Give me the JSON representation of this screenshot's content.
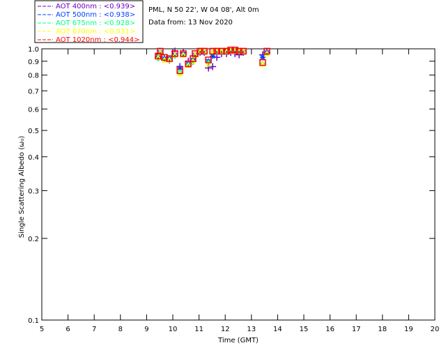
{
  "header": {
    "site": "PML, N 50 22', W 04 08', Alt 0m",
    "date": "Data from: 13 Nov 2020"
  },
  "chart_data": {
    "type": "scatter",
    "xlabel": "Time (GMT)",
    "ylabel": "Single Scattering Albedo (ω₀)",
    "xlim": [
      5,
      20
    ],
    "ylim": [
      0.1,
      1.0
    ],
    "yscale": "log",
    "xticks": [
      "5",
      "6",
      "7",
      "8",
      "9",
      "10",
      "11",
      "12",
      "13",
      "14",
      "15",
      "16",
      "17",
      "18",
      "19",
      "20"
    ],
    "yticks": [
      "0.1",
      "0.2",
      "0.3",
      "0.4",
      "0.5",
      "0.6",
      "0.7",
      "0.8",
      "0.9",
      "1.0"
    ],
    "legend_position": "top-left",
    "series": [
      {
        "name": "AOT  400nm : <0.939>",
        "color": "#6a00c0",
        "marker": "plus",
        "x": [
          9.52,
          9.44,
          9.68,
          9.87,
          10.08,
          10.27,
          10.4,
          10.59,
          10.77,
          10.85,
          11.04,
          11.2,
          11.36,
          11.52,
          11.68,
          11.86,
          12.05,
          12.21,
          12.37,
          12.53,
          12.69,
          13.43,
          13.59
        ],
        "y": [
          0.95,
          0.93,
          0.92,
          0.91,
          0.98,
          0.86,
          0.97,
          0.9,
          0.9,
          0.94,
          0.97,
          0.97,
          0.85,
          0.86,
          0.93,
          0.96,
          0.96,
          0.97,
          0.96,
          0.95,
          0.97,
          0.95,
          0.97
        ]
      },
      {
        "name": "AOT  500nm : <0.938>",
        "color": "#0040ff",
        "marker": "star",
        "x": [
          9.52,
          9.44,
          9.68,
          9.87,
          10.08,
          10.27,
          10.4,
          10.59,
          10.77,
          10.85,
          11.04,
          11.2,
          11.36,
          11.52,
          11.68,
          11.86,
          12.05,
          12.21,
          12.37,
          12.53,
          12.69,
          13.43,
          13.59
        ],
        "y": [
          0.97,
          0.94,
          0.92,
          0.92,
          0.95,
          0.85,
          0.95,
          0.88,
          0.91,
          0.95,
          0.97,
          0.97,
          0.9,
          0.94,
          0.97,
          0.97,
          0.97,
          0.98,
          0.98,
          0.97,
          0.97,
          0.93,
          0.97
        ]
      },
      {
        "name": "AOT  675nm : <0.928>",
        "color": "#00ff80",
        "marker": "diamond",
        "x": [
          9.52,
          9.44,
          9.68,
          9.87,
          10.08,
          10.27,
          10.4,
          10.59,
          10.77,
          10.85,
          11.04,
          11.2,
          11.36,
          11.52,
          11.68,
          11.86,
          12.05,
          12.21,
          12.37,
          12.53,
          12.69,
          13.43,
          13.59
        ],
        "y": [
          0.96,
          0.92,
          0.91,
          0.91,
          0.94,
          0.82,
          0.95,
          0.87,
          0.9,
          0.94,
          0.97,
          0.97,
          0.89,
          0.97,
          0.97,
          0.97,
          0.97,
          0.98,
          0.98,
          0.97,
          0.97,
          0.88,
          0.96
        ]
      },
      {
        "name": "AOT  870nm : <0.931>",
        "color": "#ffff00",
        "marker": "triangle",
        "x": [
          9.52,
          9.44,
          9.68,
          9.87,
          10.08,
          10.27,
          10.4,
          10.59,
          10.77,
          10.85,
          11.04,
          11.2,
          11.36,
          11.52,
          11.68,
          11.86,
          12.05,
          12.21,
          12.37,
          12.53,
          12.69,
          13.43,
          13.59
        ],
        "y": [
          0.97,
          0.93,
          0.91,
          0.91,
          0.95,
          0.81,
          0.95,
          0.87,
          0.9,
          0.95,
          0.98,
          0.98,
          0.88,
          0.98,
          0.98,
          0.98,
          0.98,
          0.98,
          0.98,
          0.98,
          0.98,
          0.88,
          0.96
        ]
      },
      {
        "name": "AOT 1020nm : <0.944>",
        "color": "#ff0000",
        "marker": "square",
        "x": [
          9.52,
          9.44,
          9.68,
          9.87,
          10.08,
          10.27,
          10.4,
          10.59,
          10.77,
          10.85,
          11.04,
          11.2,
          11.36,
          11.52,
          11.68,
          11.86,
          12.05,
          12.21,
          12.37,
          12.53,
          12.69,
          13.43,
          13.59
        ],
        "y": [
          0.98,
          0.94,
          0.93,
          0.92,
          0.96,
          0.83,
          0.96,
          0.88,
          0.92,
          0.96,
          0.98,
          0.98,
          0.91,
          0.98,
          0.98,
          0.98,
          0.98,
          0.99,
          0.99,
          0.98,
          0.98,
          0.89,
          0.98
        ]
      }
    ]
  }
}
